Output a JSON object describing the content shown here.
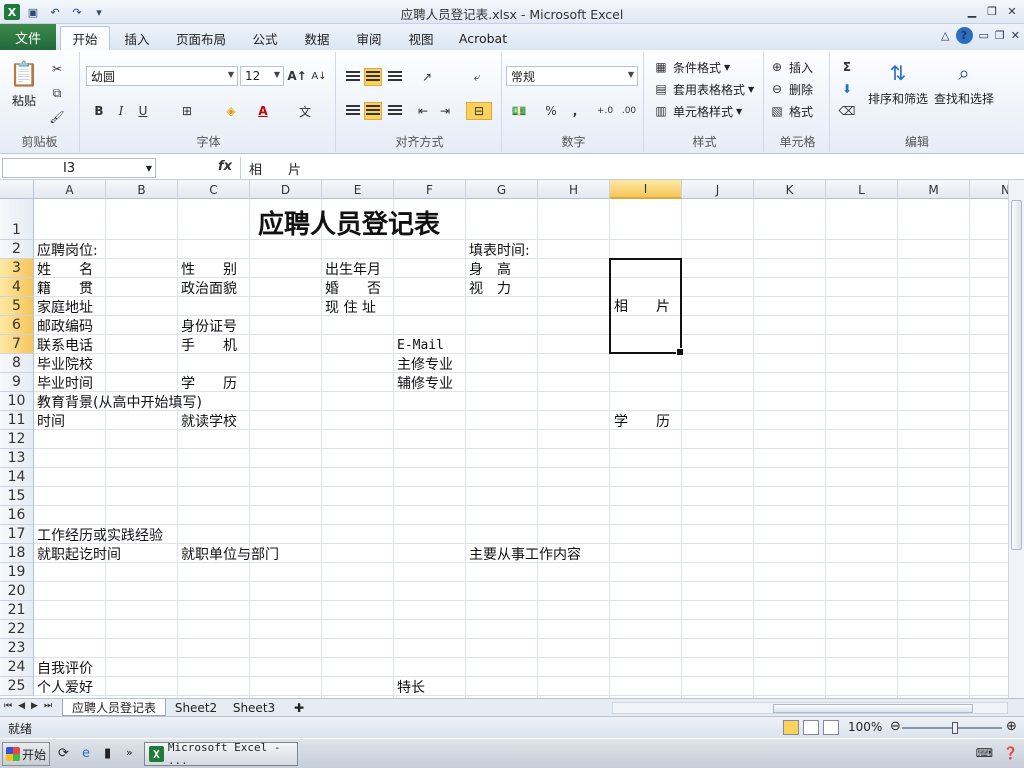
{
  "window": {
    "title": "应聘人员登记表.xlsx - Microsoft Excel"
  },
  "ribbon_tabs": {
    "file": "文件",
    "home": "开始",
    "insert": "插入",
    "layout": "页面布局",
    "formula": "公式",
    "data": "数据",
    "review": "审阅",
    "view": "视图",
    "acrobat": "Acrobat"
  },
  "ribbon": {
    "clipboard": {
      "paste": "粘贴",
      "label": "剪贴板"
    },
    "font": {
      "name": "幼圆",
      "size": "12",
      "bold": "B",
      "italic": "I",
      "underline": "U",
      "label": "字体"
    },
    "align": {
      "label": "对齐方式"
    },
    "number": {
      "format": "常规",
      "percent": "%",
      "comma": ",",
      "inc_dec": "+.0",
      "dec_dec": ".00",
      "label": "数字"
    },
    "styles": {
      "conditional": "条件格式",
      "table": "套用表格格式",
      "cell": "单元格样式",
      "label": "样式"
    },
    "cells": {
      "insert": "插入",
      "delete": "删除",
      "format": "格式",
      "label": "单元格"
    },
    "editing": {
      "sum": "Σ",
      "sort": "排序和筛选",
      "find": "查找和选择",
      "label": "编辑"
    }
  },
  "formula_bar": {
    "name_box": "I3",
    "fx": "fx",
    "value": "相　　片"
  },
  "columns": [
    "A",
    "B",
    "C",
    "D",
    "E",
    "F",
    "G",
    "H",
    "I",
    "J",
    "K",
    "L",
    "M",
    "N"
  ],
  "rows": [
    "1",
    "2",
    "3",
    "4",
    "5",
    "6",
    "7",
    "8",
    "9",
    "10",
    "11",
    "12",
    "13",
    "14",
    "15",
    "16",
    "17",
    "18",
    "19",
    "20",
    "21",
    "22",
    "23",
    "24",
    "25"
  ],
  "cells": {
    "title": "应聘人员登记表",
    "A2": "应聘岗位:",
    "G2": "填表时间:",
    "A3": "姓　　名",
    "C3": "性　　别",
    "E3": "出生年月",
    "G3": "身　高",
    "A4": "籍　　贯",
    "C4": "政治面貌",
    "E4": "婚　　否",
    "G4": "视　力",
    "A5": "家庭地址",
    "E5": "现 住 址",
    "I5": "相　　片",
    "A6": "邮政编码",
    "C6": "身份证号",
    "A7": "联系电话",
    "C7": "手　　机",
    "F7": "E-Mail",
    "A8": "毕业院校",
    "F8": "主修专业",
    "A9": "毕业时间",
    "C9": "学　　历",
    "F9": "辅修专业",
    "A10": "教育背景(从高中开始填写)",
    "A11": "时间",
    "C11": "就读学校",
    "I11": "学　　历",
    "A17": "工作经历或实践经验",
    "A18": "就职起讫时间",
    "C18": "就职单位与部门",
    "G18": "主要从事工作内容",
    "A24": "自我评价",
    "A25": "个人爱好",
    "F25": "特长"
  },
  "sheets": [
    "应聘人员登记表",
    "Sheet2",
    "Sheet3"
  ],
  "status": {
    "ready": "就绪",
    "zoom": "100%"
  },
  "taskbar": {
    "start": "开始",
    "task": "Microsoft Excel - ..."
  }
}
